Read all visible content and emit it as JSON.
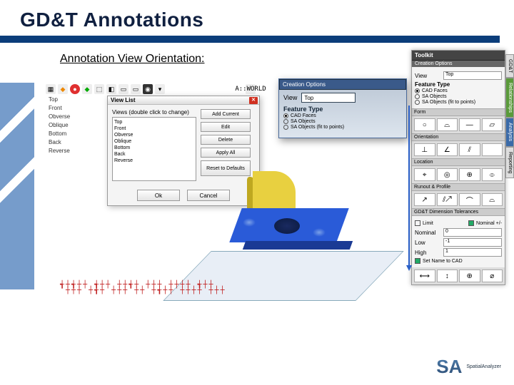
{
  "slide": {
    "title": "GD&T Annotations",
    "subtitle": "Annotation View Orientation:"
  },
  "toolbar": {
    "world_label": "A::WORLD"
  },
  "view_names": [
    "Top",
    "Front",
    "Obverse",
    "Oblique",
    "Bottom",
    "Back",
    "Reverse"
  ],
  "view_list_dialog": {
    "title": "View List",
    "header": "Views (double click to change)",
    "items": [
      "Top",
      "Front",
      "Obverse",
      "Oblique",
      "Bottom",
      "Back",
      "Reverse"
    ],
    "buttons": {
      "add": "Add Current",
      "edit": "Edit",
      "delete": "Delete",
      "apply_all": "Apply All",
      "reset": "Reset to Defaults",
      "ok": "Ok",
      "cancel": "Cancel"
    }
  },
  "popout": {
    "header": "Creation Options",
    "view_label": "View",
    "view_value": "Top",
    "ft_header": "Feature Type",
    "radios": [
      "CAD Faces",
      "SA Objects",
      "SA Objects (fit to points)"
    ],
    "selected": 0
  },
  "toolkit": {
    "title": "Toolkit",
    "sub_creation": "Creation Options",
    "view_label": "View",
    "view_value": "Top",
    "ft_header": "Feature Type",
    "ft_radios": [
      "CAD Faces",
      "SA Objects",
      "SA Objects (fit to points)"
    ],
    "ft_selected": 0,
    "form_header": "Form",
    "orient_header": "Orientation",
    "loc_header": "Location",
    "runout_header": "Runout & Profile",
    "dim_header": "GD&T Dimension Tolerances",
    "limit_ck": "Limit",
    "nominal_ck": "Nominal +/-",
    "nominal_label": "Nominal",
    "nominal_val": "0",
    "low_label": "Low",
    "low_val": "-1",
    "high_label": "High",
    "high_val": "1",
    "setname_ck": "Set Name to CAD",
    "form_syms": [
      "○",
      "⌓",
      "—",
      "▱"
    ],
    "orient_syms": [
      "⊥",
      "∠",
      "⫽",
      ""
    ],
    "loc_syms": [
      "⌖",
      "◎",
      "⊕",
      "⌯"
    ],
    "run_syms": [
      "↗",
      "⫽↗",
      "⌒",
      "⌓"
    ],
    "dim_syms": [
      "⟷",
      "↕",
      "⊕",
      "⌀"
    ]
  },
  "vtabs": [
    "GD&T",
    "Relationships",
    "Analysis",
    "Reporting"
  ],
  "logo": {
    "brand": "SA",
    "sub": "SpatialAnalyzer"
  }
}
